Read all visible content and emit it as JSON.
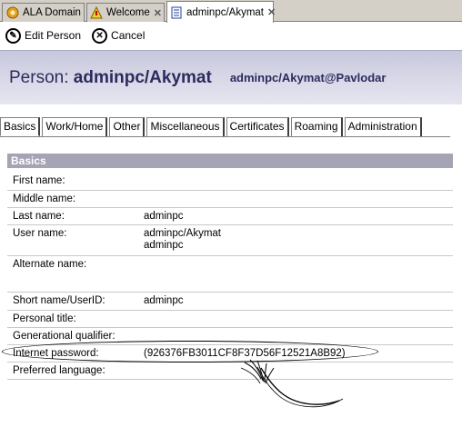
{
  "window_tabs": [
    {
      "label": "ALA Domain",
      "icon": "domain-icon",
      "closable": false,
      "active": false
    },
    {
      "label": "Welcome",
      "icon": "welcome-icon",
      "closable": true,
      "active": false
    },
    {
      "label": "adminpc/Akymat",
      "icon": "document-icon",
      "closable": true,
      "active": true
    }
  ],
  "actions": {
    "edit_label": "Edit Person",
    "cancel_label": "Cancel"
  },
  "header": {
    "prefix": "Person:",
    "name": "adminpc/Akymat",
    "email": "adminpc/Akymat@Pavlodar"
  },
  "form_tabs": [
    "Basics",
    "Work/Home",
    "Other",
    "Miscellaneous",
    "Certificates",
    "Roaming",
    "Administration"
  ],
  "section_title": "Basics",
  "fields": {
    "first_name": {
      "label": "First name:",
      "value": ""
    },
    "middle_name": {
      "label": "Middle name:",
      "value": ""
    },
    "last_name": {
      "label": "Last name:",
      "value": "adminpc"
    },
    "user_name": {
      "label": "User name:",
      "value1": "adminpc/Akymat",
      "value2": "adminpc"
    },
    "alternate_name": {
      "label": "Alternate name:",
      "value": ""
    },
    "short_name": {
      "label": "Short name/UserID:",
      "value": "adminpc"
    },
    "personal_title": {
      "label": "Personal title:",
      "value": ""
    },
    "gen_qualifier": {
      "label": "Generational qualifier:",
      "value": ""
    },
    "internet_password": {
      "label": "Internet password:",
      "value": "(926376FB3011CF8F37D56F12521A8B92)"
    },
    "preferred_language": {
      "label": "Preferred language:",
      "value": ""
    }
  },
  "colors": {
    "header_text": "#2b2b5e",
    "section_bg": "#a4a4b4"
  }
}
